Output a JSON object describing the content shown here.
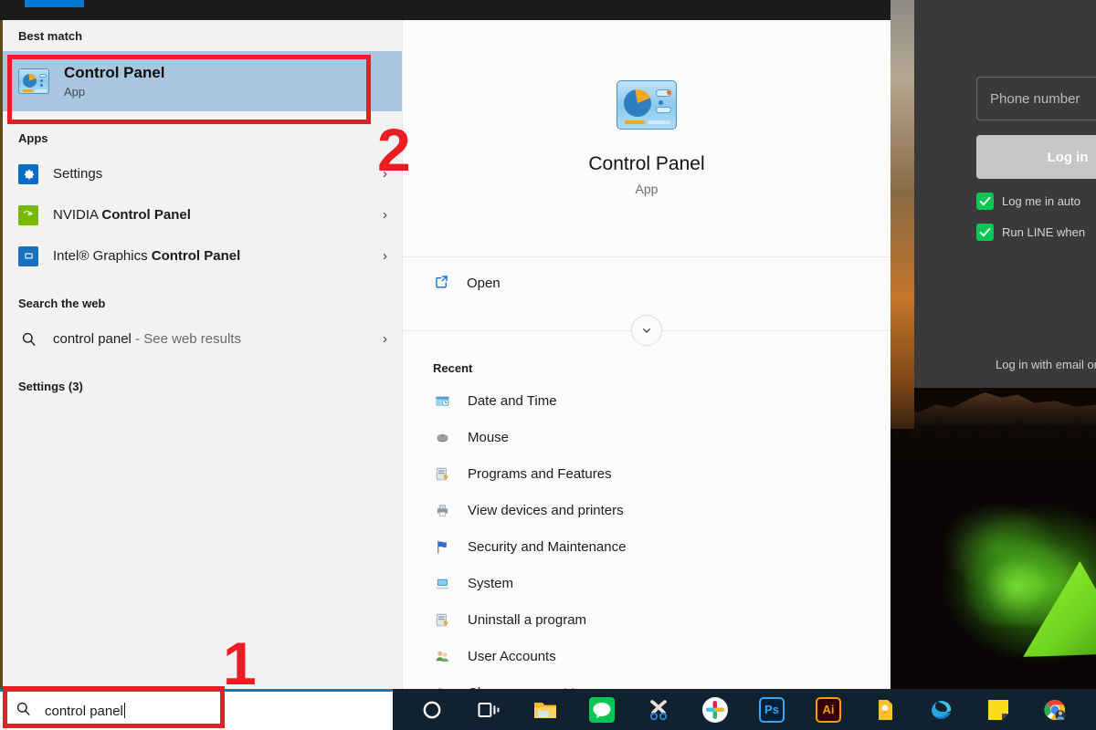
{
  "desktop": {
    "line_window": {
      "phone_field_placeholder": "Phone number",
      "login_button": "Log in",
      "checkbox_auto_login": "Log me in auto",
      "checkbox_run_on_start": "Run LINE when",
      "alt_login_link": "Log in with email or"
    }
  },
  "search_flyout": {
    "best_match": {
      "header": "Best match",
      "title": "Control Panel",
      "subtitle": "App",
      "icon": "control-panel-icon"
    },
    "apps": {
      "header": "Apps",
      "items": [
        {
          "label_plain": "Settings",
          "label_bold": "",
          "icon": "settings-gear-icon",
          "chevron": "›"
        },
        {
          "label_plain": "NVIDIA ",
          "label_bold": "Control Panel",
          "icon": "nvidia-icon",
          "chevron": "›"
        },
        {
          "label_plain": "Intel® Graphics ",
          "label_bold": "Control Panel",
          "icon": "intel-icon",
          "chevron": "›"
        }
      ]
    },
    "search_web": {
      "header": "Search the web",
      "query": "control panel",
      "suffix": " - See web results",
      "icon": "search-magnifier-icon",
      "chevron": "›"
    },
    "settings_section": {
      "header": "Settings (3)"
    },
    "preview": {
      "title": "Control Panel",
      "subtitle": "App",
      "icon": "control-panel-icon",
      "open_label": "Open",
      "open_icon": "external-link-icon",
      "expander_icon": "chevron-down-icon",
      "recent_header": "Recent",
      "recent_items": [
        {
          "label": "Date and Time",
          "icon": "date-time-icon"
        },
        {
          "label": "Mouse",
          "icon": "mouse-icon"
        },
        {
          "label": "Programs and Features",
          "icon": "programs-features-icon"
        },
        {
          "label": "View devices and printers",
          "icon": "devices-printers-icon"
        },
        {
          "label": "Security and Maintenance",
          "icon": "flag-icon"
        },
        {
          "label": "System",
          "icon": "system-icon"
        },
        {
          "label": "Uninstall a program",
          "icon": "programs-features-icon"
        },
        {
          "label": "User Accounts",
          "icon": "user-accounts-icon"
        },
        {
          "label": "Change account type",
          "icon": "user-accounts-icon"
        }
      ]
    }
  },
  "taskbar": {
    "search": {
      "value": "control panel",
      "icon": "search-magnifier-icon"
    },
    "items": [
      {
        "name": "cortana-icon",
        "label": ""
      },
      {
        "name": "task-view-icon",
        "label": ""
      },
      {
        "name": "file-explorer-icon",
        "label": ""
      },
      {
        "name": "line-icon",
        "label": ""
      },
      {
        "name": "snipping-tool-icon",
        "label": ""
      },
      {
        "name": "slack-icon",
        "label": ""
      },
      {
        "name": "photoshop-icon",
        "label": "Ps"
      },
      {
        "name": "illustrator-icon",
        "label": "Ai"
      },
      {
        "name": "keep-notes-icon",
        "label": ""
      },
      {
        "name": "microsoft-edge-icon",
        "label": ""
      },
      {
        "name": "sticky-notes-icon",
        "label": ""
      },
      {
        "name": "google-chrome-icon",
        "label": ""
      },
      {
        "name": "pink-bracket-icon",
        "label": "›"
      }
    ]
  },
  "annotations": {
    "step_one": "1",
    "step_two": "2",
    "color": "#ec1c24"
  }
}
